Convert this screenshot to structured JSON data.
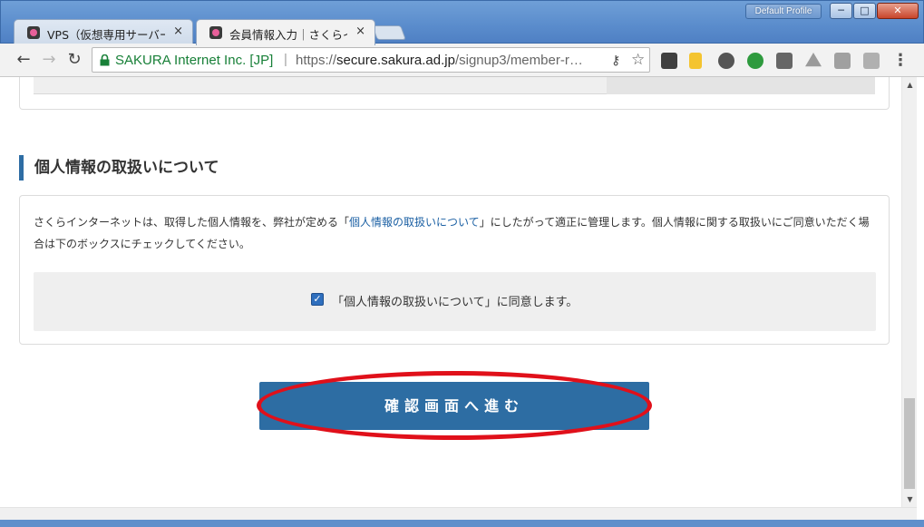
{
  "browser": {
    "profile_label": "Default Profile",
    "window_controls": {
      "minimize": "─",
      "maximize": "□",
      "close": "✕"
    },
    "tabs": [
      {
        "title": "VPS（仮想専用サーバー",
        "close": "×"
      },
      {
        "title": "会員情報入力｜さくらイ",
        "close": "×"
      }
    ],
    "omnibox": {
      "secure_name": "SAKURA Internet Inc. [JP]",
      "separator": "|",
      "url_scheme": "https://",
      "url_host": "secure.sakura.ad.jp",
      "url_path": "/signup3/member-r…"
    },
    "nav": {
      "back": "←",
      "forward": "→",
      "reload": "↻"
    },
    "icons": {
      "key": "⚷",
      "star": "☆",
      "menu": "⋮"
    }
  },
  "page": {
    "section_heading": "個人情報の取扱いについて",
    "description_before": "さくらインターネットは、取得した個人情報を、弊社が定める「",
    "description_link": "個人情報の取扱いについて",
    "description_after": "」にしたがって適正に管理します。個人情報に関する取扱いにご同意いただく場合は下のボックスにチェックしてください。",
    "checkbox_checked": true,
    "checkbox_mark": "✓",
    "agree_label": "「個人情報の取扱いについて」に同意します。",
    "confirm_button_label": "確認画面へ進む"
  },
  "scrollbar": {
    "up": "▲",
    "down": "▼"
  },
  "colors": {
    "accent": "#2d6da3",
    "link": "#1a5fa3",
    "annotation": "#e0101a",
    "secure": "#188038"
  }
}
